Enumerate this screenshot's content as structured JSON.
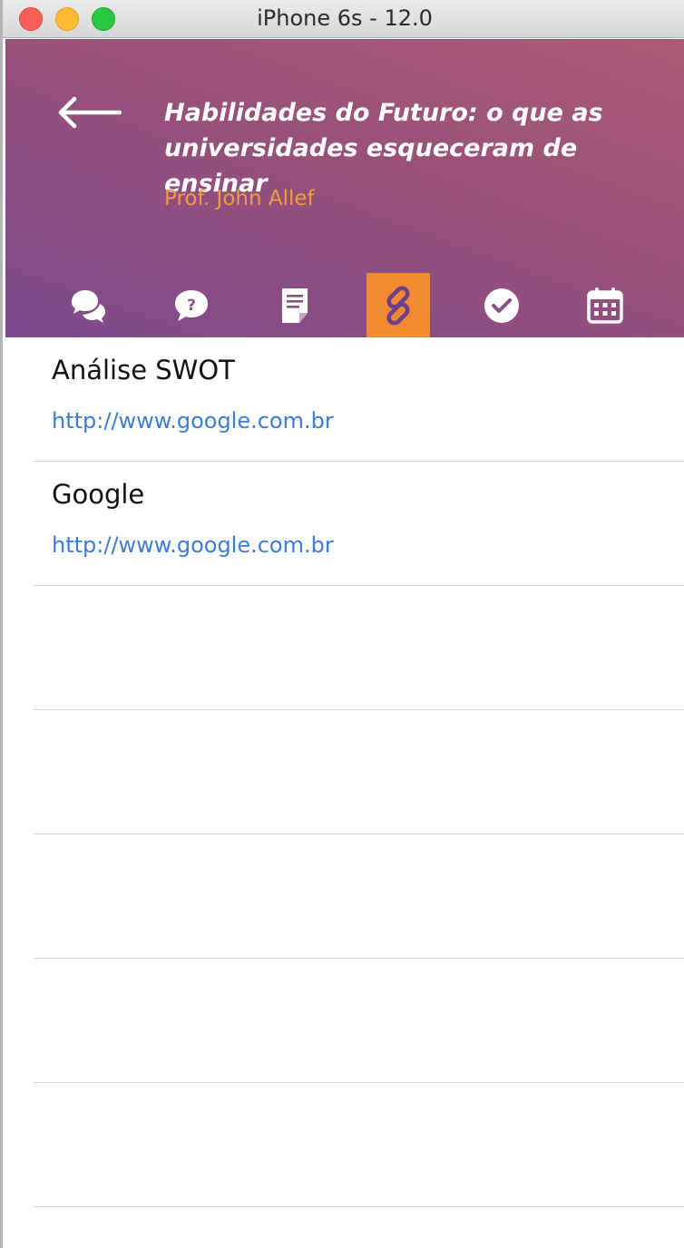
{
  "window": {
    "title": "iPhone 6s - 12.0"
  },
  "header": {
    "course_title": "Habilidades do Futuro: o que as universidades esqueceram de ensinar",
    "professor": "Prof. John Allef"
  },
  "tabs": [
    {
      "icon": "chat-bubbles-icon",
      "active": false
    },
    {
      "icon": "question-icon",
      "active": false
    },
    {
      "icon": "document-icon",
      "active": false
    },
    {
      "icon": "link-icon",
      "active": true
    },
    {
      "icon": "check-circle-icon",
      "active": false
    },
    {
      "icon": "calendar-icon",
      "active": false
    }
  ],
  "links": [
    {
      "title": "Análise SWOT",
      "url": "http://www.google.com.br"
    },
    {
      "title": "Google",
      "url": "http://www.google.com.br"
    },
    {
      "title": "",
      "url": ""
    },
    {
      "title": "",
      "url": ""
    },
    {
      "title": "",
      "url": ""
    },
    {
      "title": "",
      "url": ""
    },
    {
      "title": "",
      "url": ""
    }
  ],
  "colors": {
    "accent": "#f28a2f",
    "link": "#3b7ddb",
    "professor": "#f29a3e",
    "header_top": "#ac5a76",
    "header_bottom": "#7d4a8e"
  }
}
